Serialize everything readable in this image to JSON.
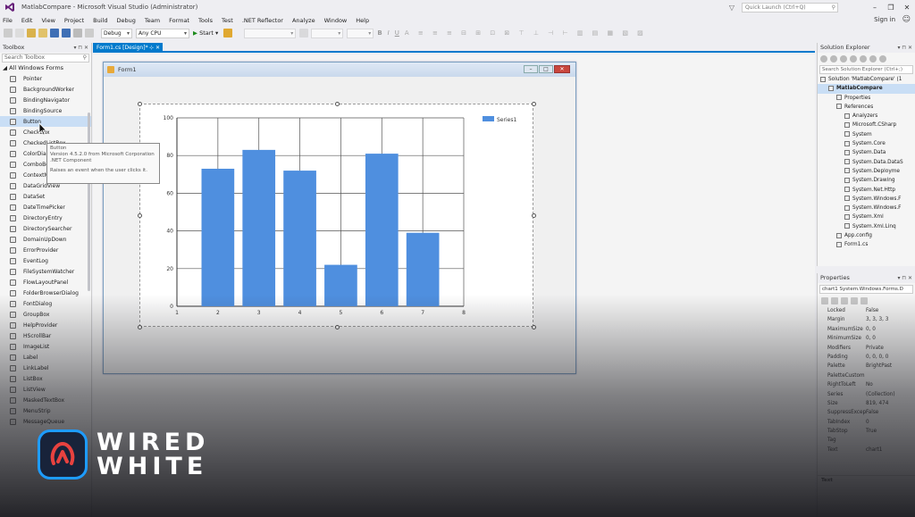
{
  "window": {
    "title": "MatlabCompare - Microsoft Visual Studio (Administrator)",
    "quick_launch_placeholder": "Quick Launch (Ctrl+Q)",
    "sign_in": "Sign in"
  },
  "menu": [
    "File",
    "Edit",
    "View",
    "Project",
    "Build",
    "Debug",
    "Team",
    "Format",
    "Tools",
    "Test",
    ".NET Reflector",
    "Analyze",
    "Window",
    "Help"
  ],
  "toolbar": {
    "config": "Debug",
    "platform": "Any CPU",
    "start": "Start"
  },
  "toolbox": {
    "title": "Toolbox",
    "search_placeholder": "Search Toolbox",
    "group": "All Windows Forms",
    "items": [
      "Pointer",
      "BackgroundWorker",
      "BindingNavigator",
      "BindingSource",
      "Button",
      "CheckBox",
      "CheckedListBox",
      "ColorDialog",
      "ComboBox",
      "ContextMenuStrip",
      "DataGridView",
      "DataSet",
      "DateTimePicker",
      "DirectoryEntry",
      "DirectorySearcher",
      "DomainUpDown",
      "ErrorProvider",
      "EventLog",
      "FileSystemWatcher",
      "FlowLayoutPanel",
      "FolderBrowserDialog",
      "FontDialog",
      "GroupBox",
      "HelpProvider",
      "HScrollBar",
      "ImageList",
      "Label",
      "LinkLabel",
      "ListBox",
      "ListView",
      "MaskedTextBox",
      "MenuStrip",
      "MessageQueue"
    ],
    "selected_index": 4
  },
  "tooltip": {
    "title": "Button",
    "line1": "Version 4.5.2.0 from Microsoft Corporation",
    "line2": ".NET Component",
    "line3": "Raises an event when the user clicks it."
  },
  "document_tab": {
    "label": "Form1.cs [Design]*"
  },
  "form": {
    "title": "Form1"
  },
  "chart_data": {
    "type": "bar",
    "x": [
      2,
      3,
      4,
      5,
      6,
      7
    ],
    "values": [
      73,
      83,
      72,
      22,
      81,
      39
    ],
    "series": [
      {
        "name": "Series1",
        "x": [
          2,
          3,
          4,
          5,
          6,
          7
        ],
        "values": [
          73,
          83,
          72,
          22,
          81,
          39
        ]
      }
    ],
    "xlim": [
      1,
      8
    ],
    "ylim": [
      0,
      100
    ],
    "xticks": [
      "1",
      "2",
      "3",
      "4",
      "5",
      "6",
      "7",
      "8"
    ],
    "yticks": [
      "0",
      "20",
      "40",
      "60",
      "80",
      "100"
    ],
    "grid": true,
    "legend": "top-right",
    "bar_color": "#4f8fdf"
  },
  "solution_explorer": {
    "title": "Solution Explorer",
    "search_placeholder": "Search Solution Explorer (Ctrl+;)",
    "rows": [
      {
        "text": "Solution 'MatlabCompare' (1",
        "indent": 0,
        "bold": false
      },
      {
        "text": "MatlabCompare",
        "indent": 1,
        "bold": true
      },
      {
        "text": "Properties",
        "indent": 2,
        "bold": false
      },
      {
        "text": "References",
        "indent": 2,
        "bold": false
      },
      {
        "text": "Analyzers",
        "indent": 3,
        "bold": false
      },
      {
        "text": "Microsoft.CSharp",
        "indent": 3,
        "bold": false
      },
      {
        "text": "System",
        "indent": 3,
        "bold": false
      },
      {
        "text": "System.Core",
        "indent": 3,
        "bold": false
      },
      {
        "text": "System.Data",
        "indent": 3,
        "bold": false
      },
      {
        "text": "System.Data.DataS",
        "indent": 3,
        "bold": false
      },
      {
        "text": "System.Deployme",
        "indent": 3,
        "bold": false
      },
      {
        "text": "System.Drawing",
        "indent": 3,
        "bold": false
      },
      {
        "text": "System.Net.Http",
        "indent": 3,
        "bold": false
      },
      {
        "text": "System.Windows.F",
        "indent": 3,
        "bold": false
      },
      {
        "text": "System.Windows.F",
        "indent": 3,
        "bold": false
      },
      {
        "text": "System.Xml",
        "indent": 3,
        "bold": false
      },
      {
        "text": "System.Xml.Linq",
        "indent": 3,
        "bold": false
      },
      {
        "text": "App.config",
        "indent": 2,
        "bold": false
      },
      {
        "text": "Form1.cs",
        "indent": 2,
        "bold": false
      }
    ]
  },
  "properties": {
    "title": "Properties",
    "object": "chart1  System.Windows.Forms.D",
    "rows": [
      {
        "name": "Locked",
        "value": "False"
      },
      {
        "name": "Margin",
        "value": "3, 3, 3, 3"
      },
      {
        "name": "MaximumSize",
        "value": "0, 0"
      },
      {
        "name": "MinimumSize",
        "value": "0, 0"
      },
      {
        "name": "Modifiers",
        "value": "Private"
      },
      {
        "name": "Padding",
        "value": "0, 0, 0, 0"
      },
      {
        "name": "Palette",
        "value": "BrightPast"
      },
      {
        "name": "PaletteCustom",
        "value": ""
      },
      {
        "name": "RightToLeft",
        "value": "No"
      },
      {
        "name": "Series",
        "value": "(Collection)"
      },
      {
        "name": "Size",
        "value": "819, 474"
      },
      {
        "name": "SuppressExcep",
        "value": "False"
      },
      {
        "name": "TabIndex",
        "value": "0"
      },
      {
        "name": "TabStop",
        "value": "True"
      },
      {
        "name": "Tag",
        "value": ""
      },
      {
        "name": "Text",
        "value": "chart1"
      }
    ],
    "desc_title": "Text"
  },
  "watermark": {
    "line1": "WIRED",
    "line2": "WHITE"
  },
  "colors": {
    "accent": "#007acc",
    "badge_border": "#1e9cff"
  }
}
